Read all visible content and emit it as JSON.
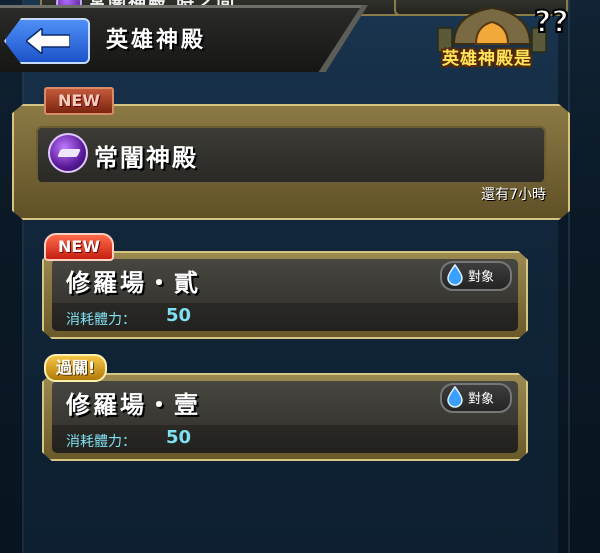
{
  "header": {
    "title": "英雄神殿",
    "back_label": "back",
    "partial_banner_text": "常闇神殿 時之間"
  },
  "logo": {
    "text": "英雄神殿是",
    "marks": "??"
  },
  "featured": {
    "badge": "NEW",
    "title": "常闇神殿",
    "time_remaining": "還有7小時",
    "icon": "dark-element-icon"
  },
  "stages": [
    {
      "badge": "NEW",
      "title": "修羅場・貳",
      "cost_label": "消耗體力：",
      "cost_value": "50",
      "target_label": "對象",
      "target_icon": "water-drop-icon"
    },
    {
      "badge": "過關!",
      "title": "修羅場・壹",
      "cost_label": "消耗體力：",
      "cost_value": "50",
      "target_label": "對象",
      "target_icon": "water-drop-icon"
    }
  ],
  "colors": {
    "accent_blue": "#2f6fe6",
    "gold_frame": "#d6c382",
    "cost_text": "#7ee0f0",
    "new_badge": "#c51f12",
    "clear_badge": "#f7c645"
  }
}
